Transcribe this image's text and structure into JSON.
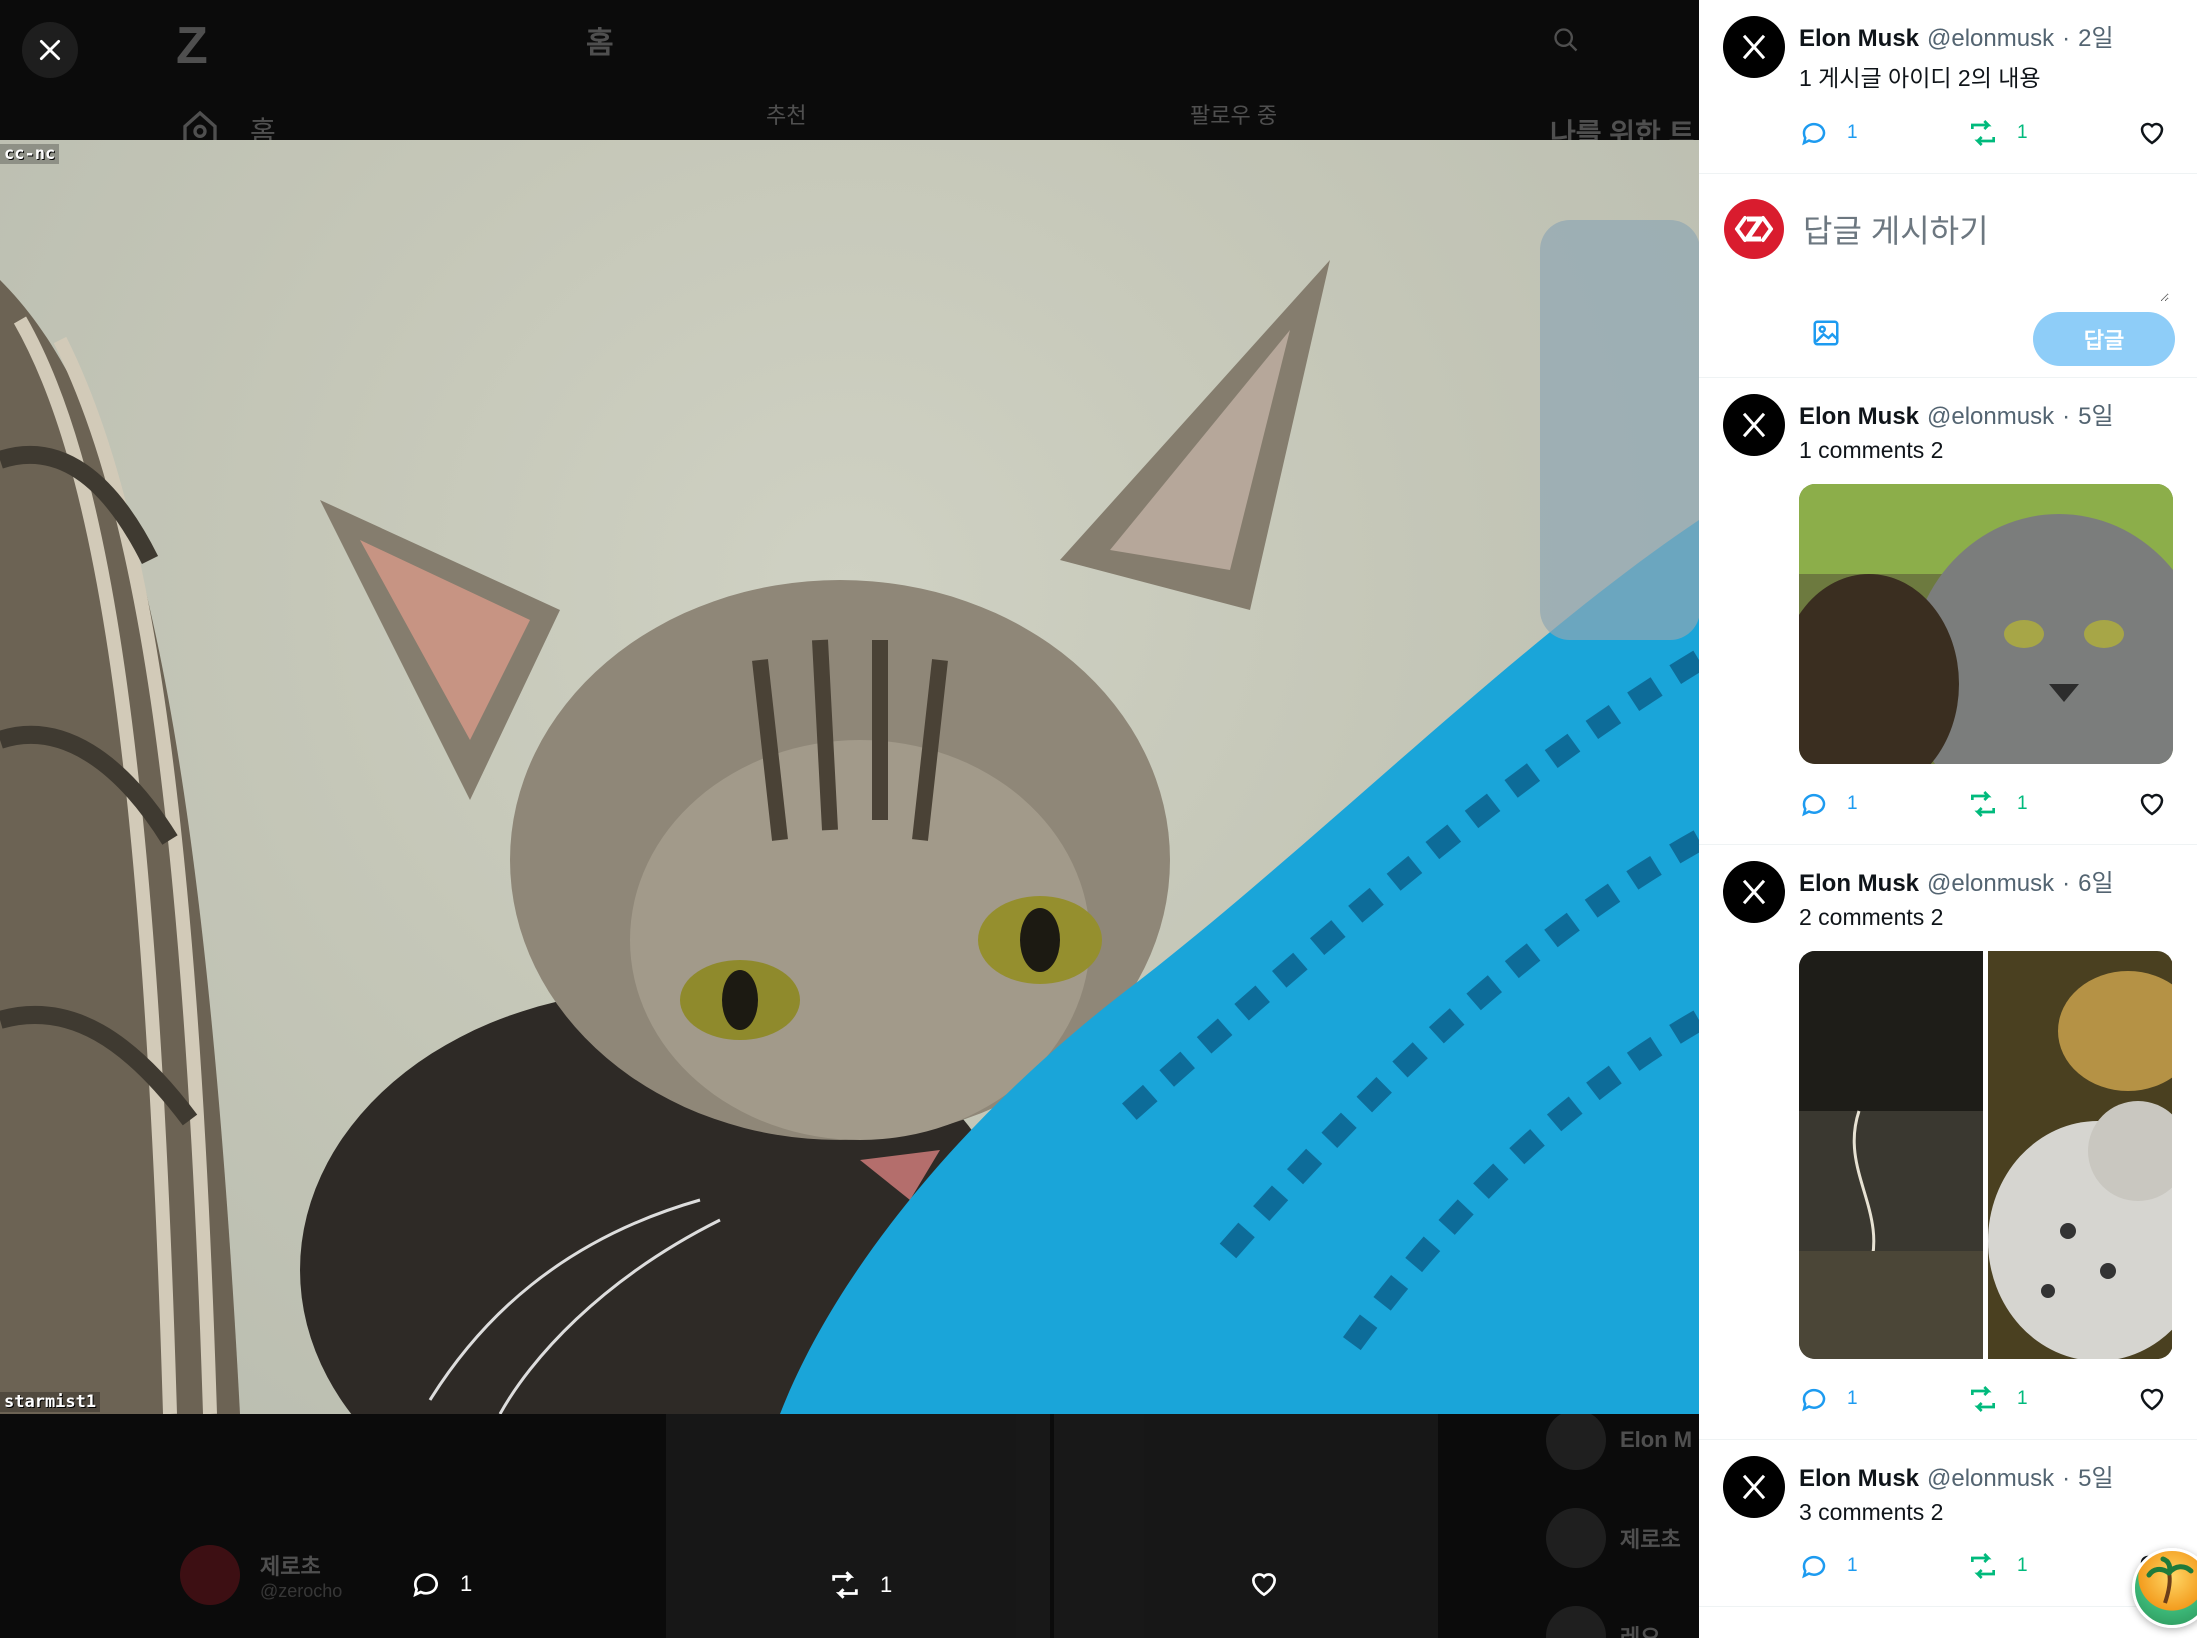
{
  "background_app": {
    "logo": "Z",
    "title": "홈",
    "nav_home": "홈",
    "tab_recommended": "추천",
    "tab_following": "팔로우 중",
    "for_you": "나를 위한 트",
    "user_name": "제로초",
    "user_handle": "@zerocho",
    "side_users": [
      "Elon M",
      "제로초",
      "레오"
    ]
  },
  "viewer": {
    "watermark_top": "cc-nc",
    "watermark_bottom": "starmist1",
    "comments": "1",
    "reposts": "1",
    "close_icon": "close-icon"
  },
  "panel": {
    "main_post": {
      "name": "Elon Musk",
      "handle": "@elonmusk",
      "time": "2일",
      "content": "1 게시글 아이디 2의 내용",
      "comments": "1",
      "reposts": "1"
    },
    "compose": {
      "placeholder": "답글 게시하기",
      "reply_label": "답글"
    },
    "comments": [
      {
        "name": "Elon Musk",
        "handle": "@elonmusk",
        "time": "5일",
        "content": "1 comments 2",
        "comments": "1",
        "reposts": "1"
      },
      {
        "name": "Elon Musk",
        "handle": "@elonmusk",
        "time": "6일",
        "content": "2 comments 2",
        "comments": "1",
        "reposts": "1"
      },
      {
        "name": "Elon Musk",
        "handle": "@elonmusk",
        "time": "5일",
        "content": "3 comments 2",
        "comments": "1",
        "reposts": "1"
      }
    ],
    "separator": "·"
  },
  "colors": {
    "comment": "#1d9bf0",
    "repost": "#00ba7c",
    "reply_button": "#8ecdf8",
    "brand_red": "#d91c2e"
  }
}
